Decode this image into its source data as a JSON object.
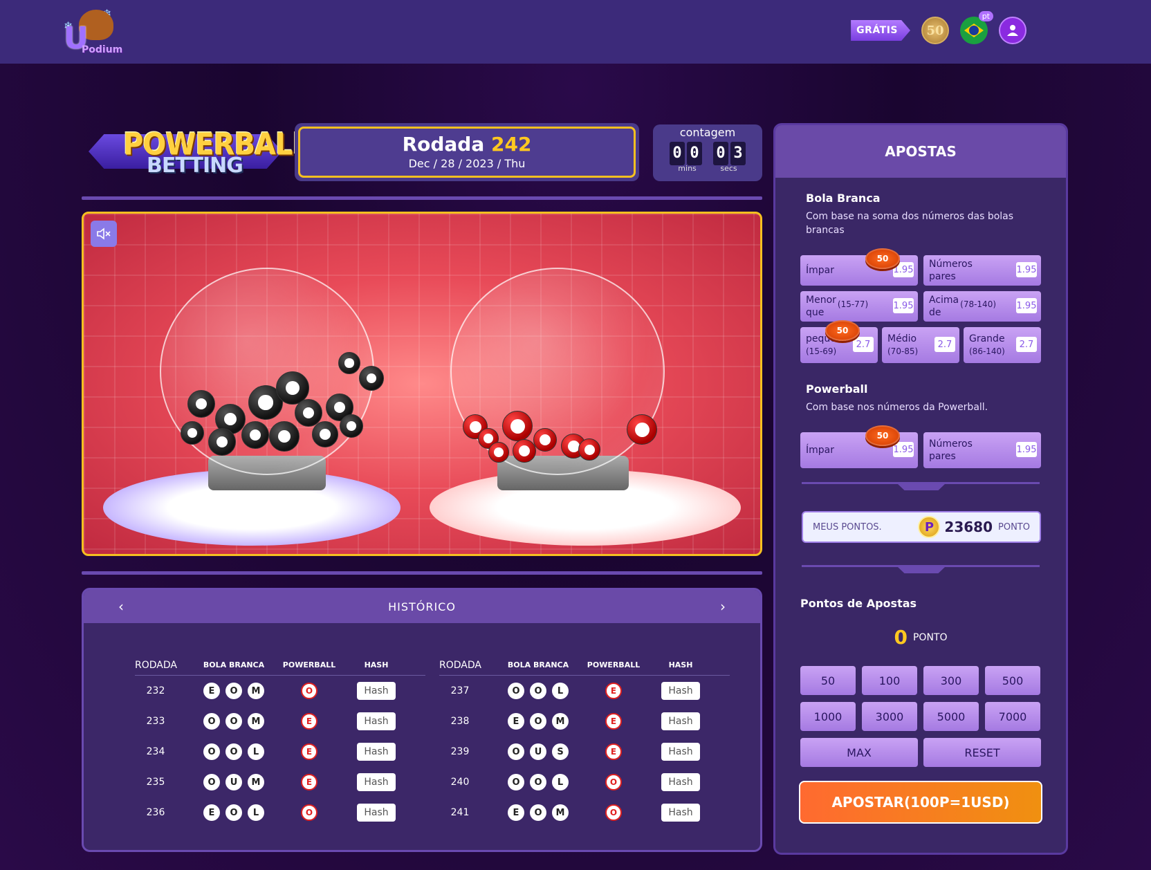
{
  "header": {
    "site_name": "Podium",
    "gratis_label": "GRÁTIS",
    "coin_value": "50",
    "lang_badge": "pt"
  },
  "game": {
    "logo_line1": "POWERBALL",
    "logo_line2": "BETTING",
    "round_label": "Rodada",
    "round_number": "242",
    "round_date": "Dec / 28 / 2023 / Thu",
    "countdown_label": "contagem",
    "digits": [
      "0",
      "0",
      "0",
      "3"
    ],
    "mins_label": "mins",
    "secs_label": "secs"
  },
  "history": {
    "title": "HISTÓRICO",
    "columns": [
      "RODADA",
      "BOLA BRANCA",
      "POWERBALL",
      "HASH"
    ],
    "hash_label": "Hash",
    "left_rows": [
      {
        "round": "232",
        "white": [
          "E",
          "O",
          "M"
        ],
        "power": "O"
      },
      {
        "round": "233",
        "white": [
          "O",
          "O",
          "M"
        ],
        "power": "E"
      },
      {
        "round": "234",
        "white": [
          "O",
          "O",
          "L"
        ],
        "power": "E"
      },
      {
        "round": "235",
        "white": [
          "O",
          "U",
          "M"
        ],
        "power": "E"
      },
      {
        "round": "236",
        "white": [
          "E",
          "O",
          "L"
        ],
        "power": "O"
      }
    ],
    "right_rows": [
      {
        "round": "237",
        "white": [
          "O",
          "O",
          "L"
        ],
        "power": "E"
      },
      {
        "round": "238",
        "white": [
          "E",
          "O",
          "M"
        ],
        "power": "E"
      },
      {
        "round": "239",
        "white": [
          "O",
          "U",
          "S"
        ],
        "power": "E"
      },
      {
        "round": "240",
        "white": [
          "O",
          "O",
          "L"
        ],
        "power": "O"
      },
      {
        "round": "241",
        "white": [
          "E",
          "O",
          "M"
        ],
        "power": "O"
      }
    ]
  },
  "bets": {
    "title": "APOSTAS",
    "white_title": "Bola Branca",
    "white_sub": "Com base na soma dos números das bolas brancas",
    "odd_label": "Ímpar",
    "even_label1": "Números",
    "even_label2": "pares",
    "under_label1": "Menor",
    "under_label2": "que",
    "under_range": "(15-77)",
    "over_label1": "Acima",
    "over_label2": "de",
    "over_range": "(78-140)",
    "small_label": "pequeno",
    "small_range": "(15-69)",
    "medium_label": "Médio",
    "medium_range": "(70-85)",
    "large_label": "Grande",
    "large_range": "(86-140)",
    "odds_195": "1.95",
    "odds_27": "2.7",
    "chip": "50",
    "power_title": "Powerball",
    "power_sub": "Com base nos números da Powerball.",
    "my_points_label": "MEUS PONTOS.",
    "my_points_value": "23680",
    "points_unit": "PONTO",
    "bet_points_title": "Pontos de Apostas",
    "bet_points_value": "0",
    "amounts": [
      "50",
      "100",
      "300",
      "500",
      "1000",
      "3000",
      "5000",
      "7000"
    ],
    "max_label": "MAX",
    "reset_label": "RESET",
    "submit_label": "APOSTAR(100P=1USD)"
  },
  "colors": {
    "accent_gold": "#f5c020",
    "panel_purple": "#6a4aa8",
    "orange": "#ff6a30"
  }
}
